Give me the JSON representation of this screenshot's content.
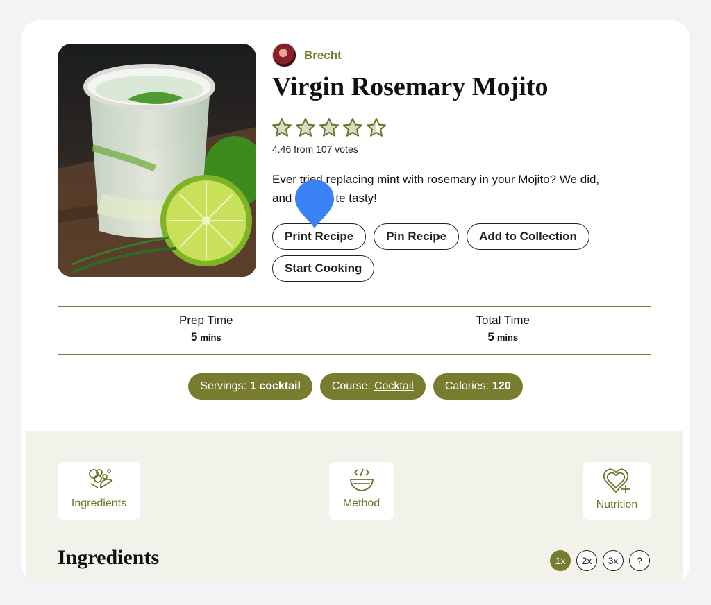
{
  "recipe": {
    "author": "Brecht",
    "title": "Virgin Rosemary Mojito",
    "rating_value": 4.46,
    "rating_stars": [
      1,
      1,
      1,
      1,
      0.5
    ],
    "rating_summary": "4.46 from 107 votes",
    "description_before": "Ever tried replacing mint with rosemary in your Mojito? We did,",
    "description_line2_start": "and",
    "description_line2_end": "te tasty!"
  },
  "actions": {
    "print": "Print Recipe",
    "pin": "Pin Recipe",
    "collection": "Add to Collection",
    "cook": "Start Cooking"
  },
  "times": [
    {
      "label": "Prep Time",
      "value": "5",
      "unit": "mins"
    },
    {
      "label": "Total Time",
      "value": "5",
      "unit": "mins"
    }
  ],
  "meta": {
    "servings_label": "Servings:",
    "servings_value": "1 cocktail",
    "course_label": "Course:",
    "course_value": "Cocktail",
    "calories_label": "Calories:",
    "calories_value": "120"
  },
  "sections": {
    "ingredients": "Ingredients",
    "method": "Method",
    "nutrition": "Nutrition"
  },
  "ingredients_heading": "Ingredients",
  "scales": [
    "1x",
    "2x",
    "3x",
    "?"
  ],
  "colors": {
    "accent": "#777c2e",
    "accent_text": "#7a7d2d",
    "panel": "#f1f2ea",
    "marker": "#3b82f6"
  },
  "icons": [
    "star-icon",
    "ingredients-icon",
    "method-bowl-icon",
    "nutrition-heart-icon",
    "map-pin-marker-icon"
  ]
}
